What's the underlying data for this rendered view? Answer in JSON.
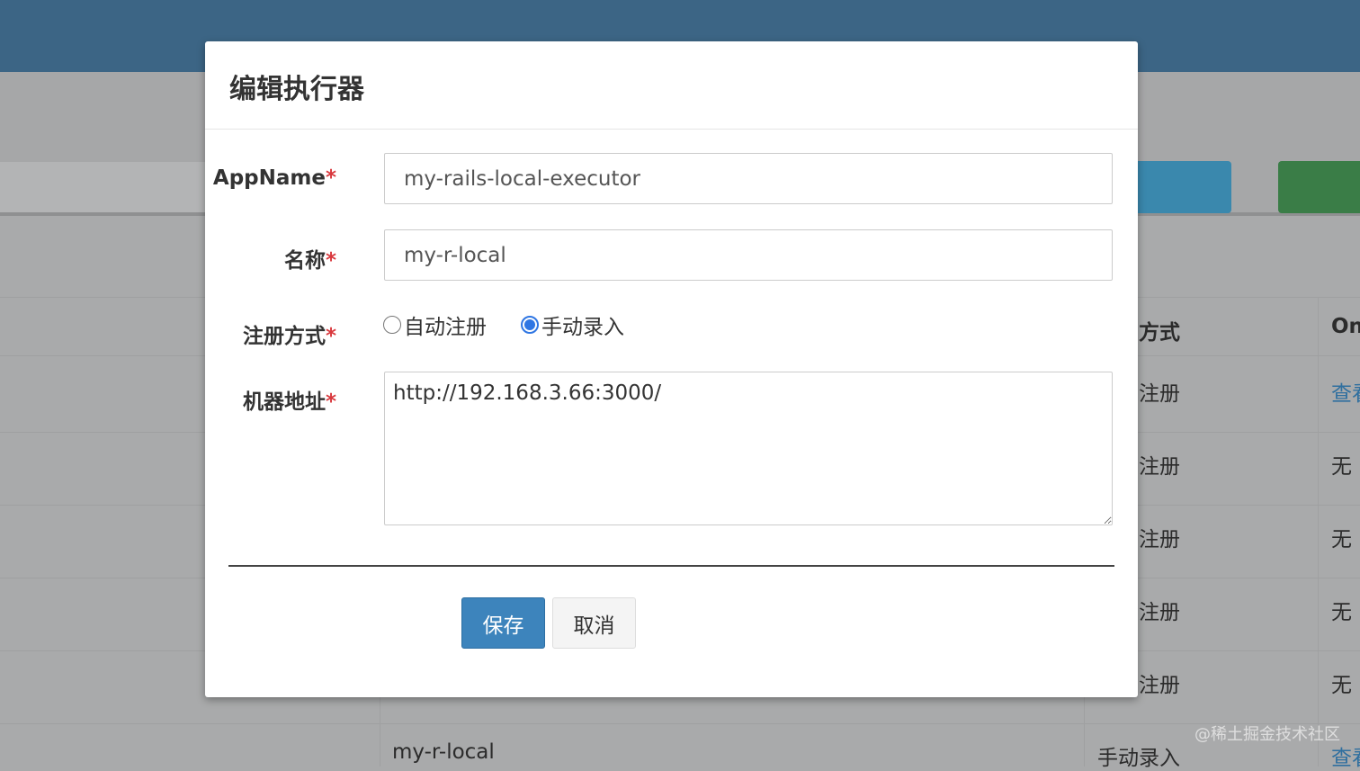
{
  "background": {
    "table": {
      "header": {
        "col_method": "方式",
        "col_online": "On"
      },
      "rows": [
        {
          "method": "注册",
          "online": "查看"
        },
        {
          "method": "注册",
          "online": "无"
        },
        {
          "method": "注册",
          "online": "无"
        },
        {
          "method": "注册",
          "online": "无"
        },
        {
          "method": "注册",
          "online": "无"
        }
      ],
      "last_row": {
        "title": "my-r-local",
        "method": "手动录入",
        "online": "查看"
      }
    },
    "watermark": "@稀土掘金技术社区"
  },
  "modal": {
    "title": "编辑执行器",
    "form": {
      "appname": {
        "label": "AppName",
        "required_mark": "*",
        "value": "my-rails-local-executor"
      },
      "name": {
        "label": "名称",
        "required_mark": "*",
        "value": "my-r-local"
      },
      "register_type": {
        "label": "注册方式",
        "required_mark": "*",
        "options": [
          "自动注册",
          "手动录入"
        ],
        "selected": "手动录入"
      },
      "address": {
        "label": "机器地址",
        "required_mark": "*",
        "value": "http://192.168.3.66:3000/"
      }
    },
    "buttons": {
      "save": "保存",
      "cancel": "取消"
    }
  },
  "colors": {
    "topbar": "#3c6585",
    "primary_button": "#3d84bc",
    "required_mark": "#d9393e",
    "radio_checked": "#2f76e3"
  }
}
